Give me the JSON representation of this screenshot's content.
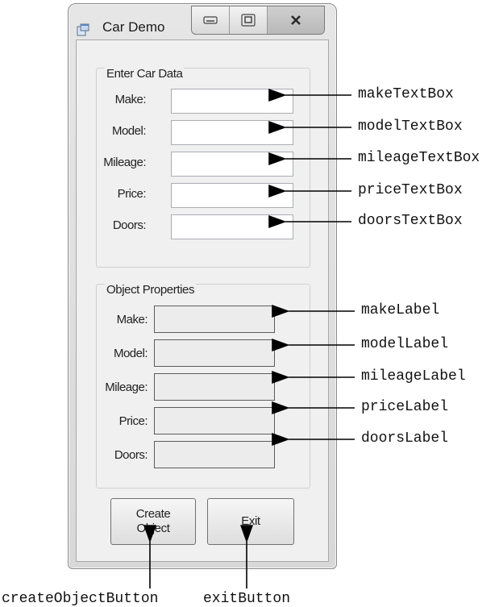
{
  "window": {
    "title": "Car Demo"
  },
  "title_buttons": {
    "minimize": "minimize",
    "maximize": "maximize",
    "close": "close"
  },
  "enter_group": {
    "title": "Enter Car Data",
    "rows": [
      {
        "label": "Make:",
        "value": ""
      },
      {
        "label": "Model:",
        "value": ""
      },
      {
        "label": "Mileage:",
        "value": ""
      },
      {
        "label": "Price:",
        "value": ""
      },
      {
        "label": "Doors:",
        "value": ""
      }
    ]
  },
  "props_group": {
    "title": "Object Properties",
    "rows": [
      {
        "label": "Make:",
        "value": ""
      },
      {
        "label": "Model:",
        "value": ""
      },
      {
        "label": "Mileage:",
        "value": ""
      },
      {
        "label": "Price:",
        "value": ""
      },
      {
        "label": "Doors:",
        "value": ""
      }
    ]
  },
  "buttons": {
    "create_line1": "Create",
    "create_line2": "Object",
    "exit": "Exit"
  },
  "callouts": {
    "textboxes": [
      "makeTextBox",
      "modelTextBox",
      "mileageTextBox",
      "priceTextBox",
      "doorsTextBox"
    ],
    "labels": [
      "makeLabel",
      "modelLabel",
      "mileageLabel",
      "priceLabel",
      "doorsLabel"
    ],
    "create_button": "createObjectButton",
    "exit_button": "exitButton"
  }
}
